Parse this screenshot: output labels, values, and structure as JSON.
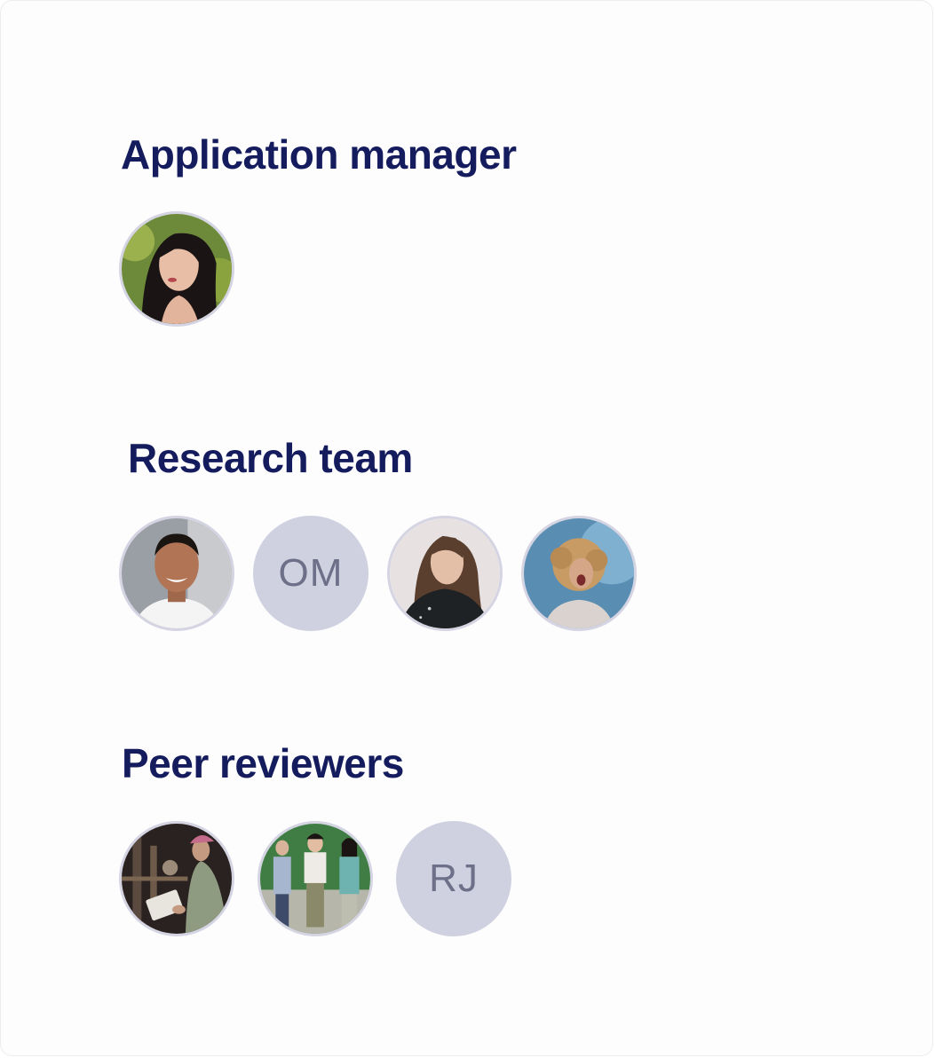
{
  "sections": [
    {
      "title": "Application manager",
      "members": [
        {
          "type": "photo",
          "icon": "woman-dark-hair-portrait-avatar"
        }
      ]
    },
    {
      "title": "Research team",
      "members": [
        {
          "type": "photo",
          "icon": "smiling-man-portrait-avatar"
        },
        {
          "type": "initials",
          "initials": "OM"
        },
        {
          "type": "photo",
          "icon": "woman-long-hair-portrait-avatar"
        },
        {
          "type": "photo",
          "icon": "curly-hair-woman-portrait-avatar"
        }
      ]
    },
    {
      "title": "Peer reviewers",
      "members": [
        {
          "type": "photo",
          "icon": "worker-with-clipboard-avatar"
        },
        {
          "type": "photo",
          "icon": "group-of-women-avatar"
        },
        {
          "type": "initials",
          "initials": "RJ"
        }
      ]
    }
  ],
  "colors": {
    "title": "#141c5e",
    "initials_bg": "#cfd1e0",
    "initials_text": "#6d7088",
    "avatar_border": "#d4d4e3"
  }
}
